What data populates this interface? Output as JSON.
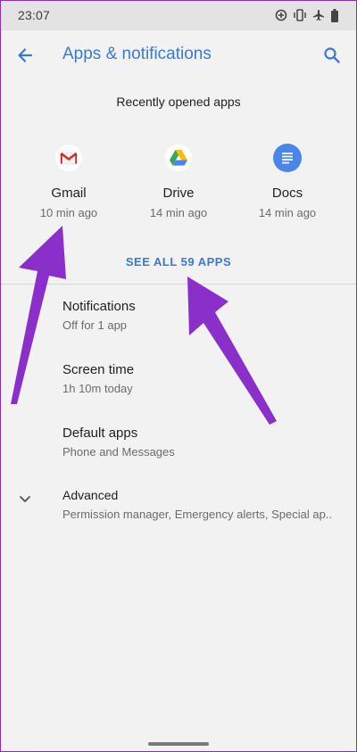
{
  "status_bar": {
    "time": "23:07",
    "icons": [
      "data-saver-icon",
      "vibrate-icon",
      "airplane-icon",
      "battery-icon"
    ]
  },
  "app_bar": {
    "title": "Apps & notifications",
    "back_icon": "back-arrow-icon",
    "search_icon": "search-icon"
  },
  "recent": {
    "title": "Recently opened apps",
    "apps": [
      {
        "name": "Gmail",
        "time": "10 min ago",
        "icon": "gmail-icon"
      },
      {
        "name": "Drive",
        "time": "14 min ago",
        "icon": "drive-icon"
      },
      {
        "name": "Docs",
        "time": "14 min ago",
        "icon": "docs-icon"
      }
    ],
    "see_all": "SEE ALL 59 APPS"
  },
  "settings": [
    {
      "title": "Notifications",
      "subtitle": "Off for 1 app"
    },
    {
      "title": "Screen time",
      "subtitle": "1h 10m today"
    },
    {
      "title": "Default apps",
      "subtitle": "Phone and Messages"
    },
    {
      "title": "Advanced",
      "subtitle": "Permission manager, Emergency alerts, Special ap..",
      "icon": "chevron-down-icon"
    }
  ],
  "colors": {
    "accent": "#3c79d6",
    "annotation_arrow": "#8a2fc9"
  }
}
